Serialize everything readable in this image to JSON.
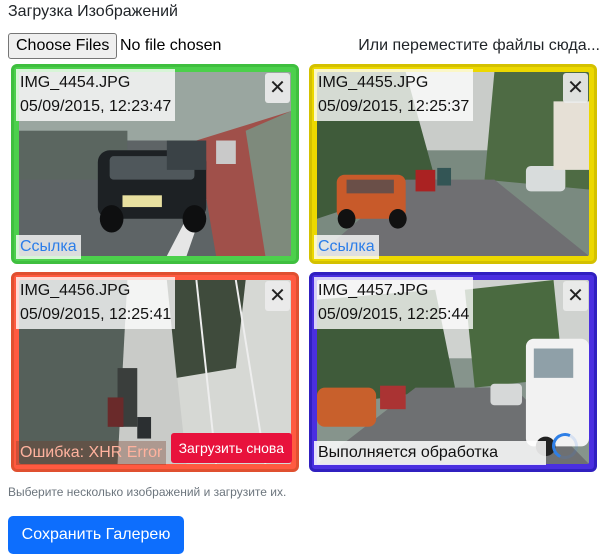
{
  "page": {
    "title": "Загрузка Изображений",
    "choose_files_label": "Choose Files",
    "no_file_text": "No file chosen",
    "drop_hint": "Или переместите файлы сюда...",
    "help_text": "Выберите несколько изображений и загрузите их.",
    "save_label": "Сохранить Галерею"
  },
  "images": [
    {
      "filename": "IMG_4454.JPG",
      "timestamp": "05/09/2015, 12:23:47",
      "close": "✕",
      "link": "Ссылка",
      "status": "uploaded",
      "border_color": "#3fbf3f"
    },
    {
      "filename": "IMG_4455.JPG",
      "timestamp": "05/09/2015, 12:25:37",
      "close": "✕",
      "link": "Ссылка",
      "status": "uploaded",
      "border_color": "#d4c100"
    },
    {
      "filename": "IMG_4456.JPG",
      "timestamp": "05/09/2015, 12:25:41",
      "close": "✕",
      "error": "Ошибка: XHR Error",
      "retry_label": "Загрузить снова",
      "status": "error",
      "border_color": "#e05030"
    },
    {
      "filename": "IMG_4457.JPG",
      "timestamp": "05/09/2015, 12:25:44",
      "close": "✕",
      "processing": "Выполняется обработка",
      "status": "processing",
      "border_color": "#3020c0"
    }
  ]
}
